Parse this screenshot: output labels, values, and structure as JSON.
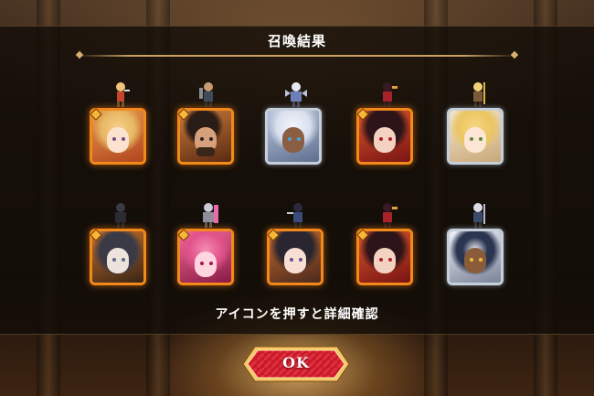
{
  "header": {
    "title": "召喚結果"
  },
  "hint_text": "アイコンを押すと詳細確認",
  "ok_button": {
    "label": "OK"
  },
  "colors": {
    "frame_gold": "#f08a1c",
    "frame_silver": "#c7cfd8",
    "button_red": "#c81a2a"
  },
  "units": [
    {
      "rarity": "gold",
      "icon": "blonde-girl-portrait-icon"
    },
    {
      "rarity": "gold",
      "icon": "bearded-man-portrait-icon"
    },
    {
      "rarity": "silver",
      "icon": "silver-hair-girl-portrait-icon"
    },
    {
      "rarity": "gold",
      "icon": "dark-hair-girl-portrait-icon"
    },
    {
      "rarity": "silver",
      "icon": "blonde-maid-portrait-icon"
    },
    {
      "rarity": "gold",
      "icon": "hooded-girl-portrait-icon"
    },
    {
      "rarity": "gold",
      "icon": "pink-armor-portrait-icon"
    },
    {
      "rarity": "gold",
      "icon": "black-hair-girl-portrait-icon"
    },
    {
      "rarity": "gold",
      "icon": "dark-hair-girl-portrait-icon"
    },
    {
      "rarity": "silver",
      "icon": "nun-portrait-icon"
    }
  ]
}
